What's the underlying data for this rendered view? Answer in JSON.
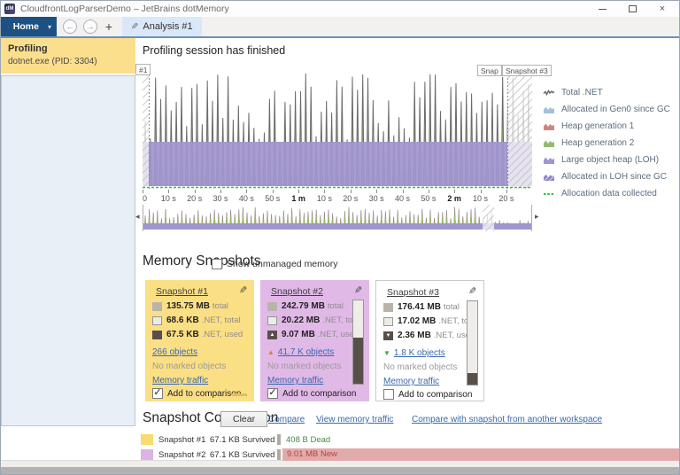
{
  "window": {
    "title": "CloudfrontLogParserDemo – JetBrains dotMemory"
  },
  "icons": {
    "check": "✓",
    "pencil": "✎",
    "caret": "▾",
    "back": "←",
    "forward": "→",
    "plus": "+",
    "up_arrow": "▲",
    "down_arrow": "▼",
    "left_scroll": "◂",
    "right_scroll": "▸",
    "close": "×"
  },
  "toolbar": {
    "home_label": "Home",
    "tab_label": "Analysis #1"
  },
  "sidebar": {
    "session_title": "Profiling",
    "session_subtitle": "dotnet.exe (PID: 3304)"
  },
  "main": {
    "status_text": "Profiling session has finished",
    "timeline": {
      "marker1": "#1",
      "marker2": "Snap",
      "marker3": "Snapshot #3",
      "axis_ticks": [
        "0",
        "10 s",
        "20 s",
        "30 s",
        "40 s",
        "50 s",
        "1 m",
        "10 s",
        "20 s",
        "30 s",
        "40 s",
        "50 s",
        "2 m",
        "10 s",
        "20 s"
      ],
      "legend": [
        {
          "label": "Total .NET",
          "type": "line",
          "color": "#6a6a6a"
        },
        {
          "label": "Allocated in Gen0 since GC",
          "type": "area",
          "color": "#a3c0dd"
        },
        {
          "label": "Heap generation 1",
          "type": "area",
          "color": "#c98784"
        },
        {
          "label": "Heap generation 2",
          "type": "area",
          "color": "#93bb6f"
        },
        {
          "label": "Large object heap (LOH)",
          "type": "area",
          "color": "#a195cf"
        },
        {
          "label": "Allocated in LOH since GC",
          "type": "area-hatch",
          "color": "#8f84c8"
        },
        {
          "label": "Allocation data collected",
          "type": "dashed",
          "color": "#35bd4a"
        }
      ]
    },
    "snapshots": {
      "heading": "Memory Snapshots",
      "show_unmanaged_label": "Show unmanaged memory",
      "cards": [
        {
          "title": "Snapshot #1",
          "stats": [
            {
              "value": "135.75 MB",
              "unit": "total"
            },
            {
              "value": "68.6 KB",
              "unit": ".NET, total"
            },
            {
              "value": "67.5 KB",
              "unit": ".NET, used"
            }
          ],
          "objects": "266 objects",
          "marked": "No marked objects",
          "traffic": "Memory traffic",
          "compare_label": "Add to comparison"
        },
        {
          "title": "Snapshot #2",
          "stats": [
            {
              "value": "242.79 MB",
              "unit": "total"
            },
            {
              "value": "20.22 MB",
              "unit": ".NET, total"
            },
            {
              "value": "9.07 MB",
              "unit": ".NET, used"
            }
          ],
          "objects": "41.7 K objects",
          "marked": "No marked objects",
          "traffic": "Memory traffic",
          "compare_label": "Add to comparison"
        },
        {
          "title": "Snapshot #3",
          "stats": [
            {
              "value": "176.41 MB",
              "unit": "total"
            },
            {
              "value": "17.02 MB",
              "unit": ".NET, total"
            },
            {
              "value": "2.36 MB",
              "unit": ".NET, used"
            }
          ],
          "objects": "1.8 K objects",
          "marked": "No marked objects",
          "traffic": "Memory traffic",
          "compare_label": "Add to comparison"
        }
      ]
    },
    "comparison": {
      "heading": "Snapshot Comparison",
      "clear_label": "Clear",
      "links": [
        "Compare",
        "View memory traffic",
        "Compare with snapshot from another workspace"
      ],
      "rows": [
        {
          "name": "Snapshot #1",
          "survived": "67.1 KB Survived",
          "delta": "408 B Dead"
        },
        {
          "name": "Snapshot #2",
          "survived": "67.1 KB Survived",
          "delta": "9.01 MB New"
        }
      ]
    }
  },
  "colors": {
    "accent_blue": "#6b90ba",
    "home_button_bg": "#1d5183",
    "sidebar_selected_bg": "#fbdf8d",
    "card1_bg": "#fbdf84",
    "card2_bg": "#e1b9e7",
    "card3_bg": "#ffffff",
    "comparison_swatch_1": "#f7dc6f",
    "comparison_swatch_2": "#dcb3e4",
    "new_bar_bg": "#e2abab",
    "new_text": "#b9413c",
    "dead_text": "#458a45"
  }
}
